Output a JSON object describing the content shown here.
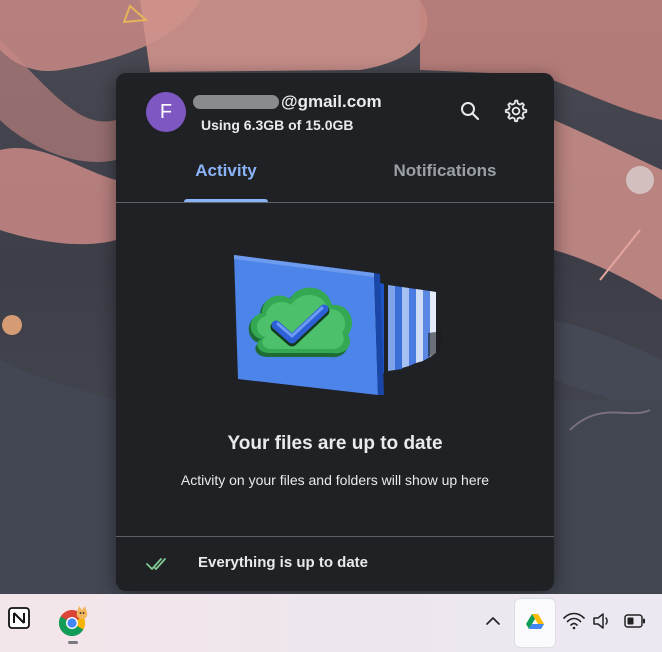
{
  "account": {
    "avatar_letter": "F",
    "email_domain": "@gmail.com",
    "storage_usage": "Using 6.3GB of 15.0GB"
  },
  "tabs": [
    {
      "label": "Activity",
      "active": true
    },
    {
      "label": "Notifications",
      "active": false
    }
  ],
  "message": {
    "title": "Your files are up to date",
    "subtitle": "Activity on your files and folders will show up here"
  },
  "footer": {
    "status": "Everything is up to date"
  },
  "colors": {
    "panel_bg": "#202124",
    "accent": "#8ab4f8",
    "avatar": "#7e57c2",
    "check_green": "#81c995"
  },
  "icons": {
    "header": [
      "search-icon",
      "gear-icon"
    ],
    "taskbar": [
      "notion-icon",
      "chrome-icon",
      "chevron-up-icon",
      "google-drive-icon",
      "wifi-icon",
      "volume-icon",
      "battery-icon"
    ]
  }
}
